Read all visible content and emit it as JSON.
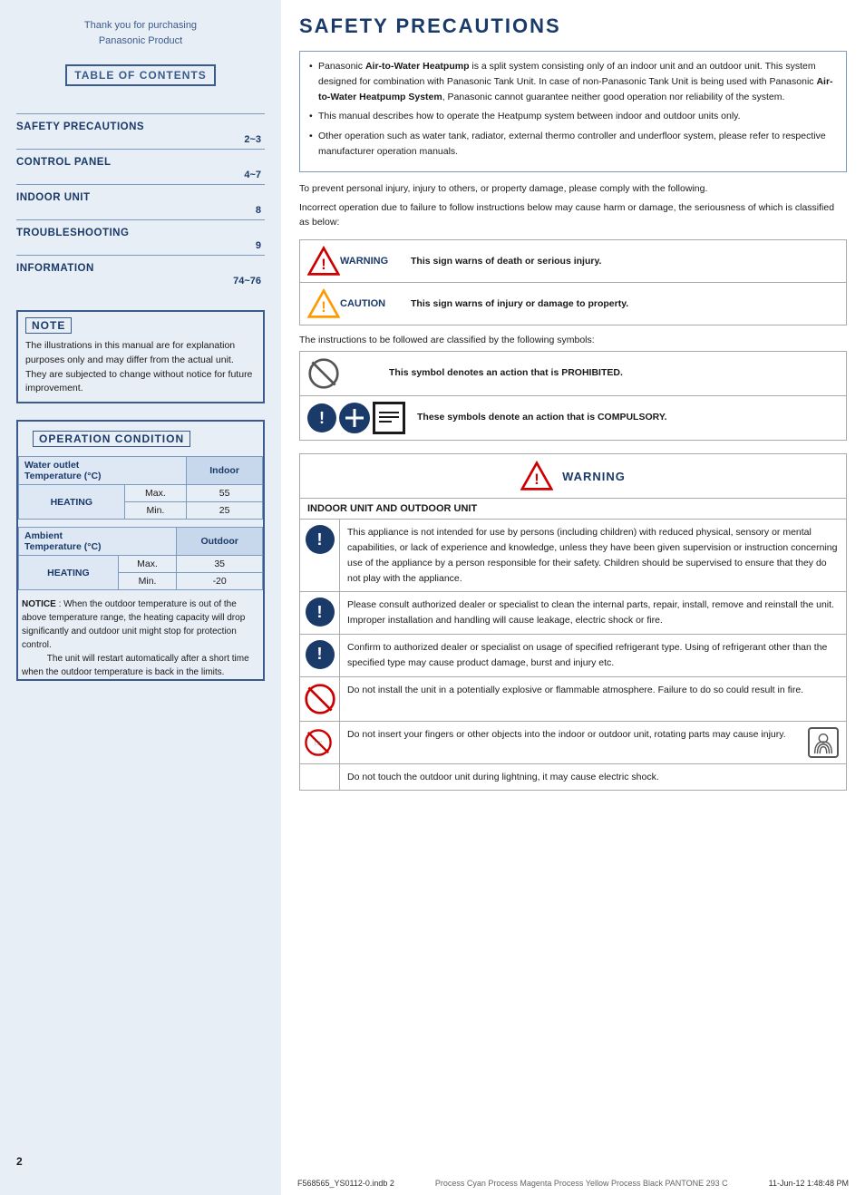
{
  "page": {
    "number": "2",
    "footer_left": "F568565_YS0112-0.indb  2",
    "footer_center": "Process Cyan  Process Magenta  Process Yellow  Process Black  PANTONE 293 C",
    "footer_right": "11-Jun-12  1:48:48 PM"
  },
  "left": {
    "intro_line1": "Thank you for purchasing",
    "intro_line2": "Panasonic Product",
    "toc_label": "TABLE OF CONTENTS",
    "sections": [
      {
        "title": "SAFETY PRECAUTIONS",
        "page": "2~3"
      },
      {
        "title": "CONTROL PANEL",
        "page": "4~7"
      },
      {
        "title": "INDOOR UNIT",
        "page": "8"
      },
      {
        "title": "TROUBLESHOOTING",
        "page": "9"
      },
      {
        "title": "INFORMATION",
        "page": "74~76"
      }
    ],
    "note_label": "NOTE",
    "note_text": "The illustrations in this manual are for explanation purposes only and may differ from the actual unit. They are subjected to change without notice for future improvement.",
    "op_cond_label": "OPERATION CONDITION",
    "table1": {
      "col_header": "Indoor",
      "row_label": "Water outlet\nTemperature (°C)",
      "heating_label": "HEATING",
      "max_label": "Max.",
      "min_label": "Min.",
      "max_val": "55",
      "min_val": "25"
    },
    "table2": {
      "col_header": "Outdoor",
      "row_label": "Ambient\nTemperature (°C)",
      "heating_label": "HEATING",
      "max_label": "Max.",
      "min_label": "Min.",
      "max_val": "35",
      "min_val": "-20"
    },
    "notice_label": "NOTICE",
    "notice_text": "When the outdoor temperature is out of the above temperature range, the heating capacity will drop significantly and outdoor unit might stop for protection control.\nThe unit will restart automatically after a short time when the outdoor temperature is back in the limits."
  },
  "right": {
    "title": "SAFETY PRECAUTIONS",
    "bullets": [
      "Panasonic Air-to-Water Heatpump is a split system consisting only of an indoor unit and an outdoor unit. This system designed for combination with Panasonic Tank Unit. In case of non-Panasonic Tank Unit is being used with Panasonic Air-to-Water Heatpump System, Panasonic cannot guarantee neither good operation nor reliability of the system.",
      "This manual describes how to operate the Heatpump system between indoor and outdoor units only.",
      "Other operation such as water tank, radiator, external thermo controller and underfloor system, please refer to respective manufacturer operation manuals."
    ],
    "comply_text1": "To prevent personal injury, injury to others, or property damage, please comply with the following.",
    "comply_text2": "Incorrect operation due to failure to follow instructions below may cause harm or damage, the seriousness of which is classified as below:",
    "warning_label": "WARNING",
    "warning_desc": "This sign warns of death or serious injury.",
    "caution_label": "CAUTION",
    "caution_desc": "This sign warns of injury or damage to property.",
    "symbols_intro": "The instructions to be followed are classified by the following symbols:",
    "sym1_text": "This symbol denotes an action that is PROHIBITED.",
    "sym2_text": "These symbols denote an action that is COMPULSORY.",
    "big_warning_label": "WARNING",
    "indoor_outdoor_title": "INDOOR UNIT AND OUTDOOR UNIT",
    "wo_rows": [
      {
        "icon": "exclaim",
        "text": "This appliance is not intended for use by persons (including children) with reduced physical, sensory or mental capabilities, or lack of experience and knowledge, unless they have been given supervision or instruction concerning use of the appliance by a person responsible for their safety. Children should be supervised to ensure that they do not play with the appliance."
      },
      {
        "icon": "exclaim",
        "text": "Please consult authorized dealer or specialist to clean the internal parts, repair, install, remove and reinstall the unit. Improper installation and handling will cause leakage, electric shock or fire."
      },
      {
        "icon": "exclaim",
        "text": "Confirm to authorized dealer or specialist on usage of specified refrigerant type. Using of refrigerant other than the specified type may cause product damage, burst and injury etc."
      },
      {
        "icon": "banned",
        "text": "Do not install the unit in a potentially explosive or flammable atmosphere. Failure to do so could result in fire."
      },
      {
        "icon": "finger-banned",
        "text": "Do not insert your fingers or other objects into the indoor or outdoor unit, rotating parts may cause injury."
      },
      {
        "icon": "none",
        "text": "Do not touch the outdoor unit during lightning, it may cause electric shock."
      }
    ]
  }
}
